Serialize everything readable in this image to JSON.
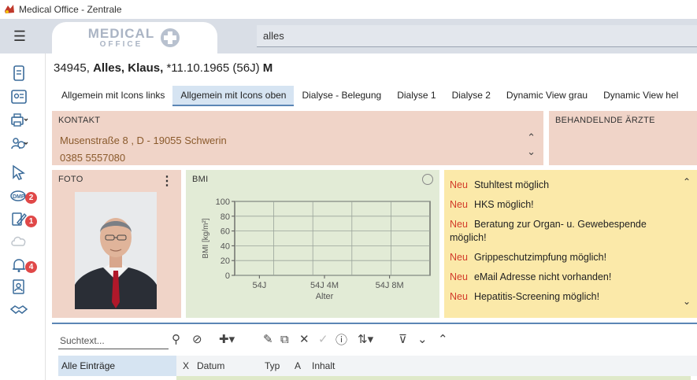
{
  "window": {
    "title": "Medical Office - Zentrale"
  },
  "header": {
    "logo_line1": "MEDICAL",
    "logo_line2": "OFFICE",
    "search_value": "alles"
  },
  "sidebar": {
    "badges": {
      "dmp": "2",
      "edit": "1",
      "bell": "4"
    },
    "icons": [
      "card-icon",
      "id-card-icon",
      "printer-icon",
      "user-clock-icon",
      "pointer-icon",
      "dmp-icon",
      "edit-document-icon",
      "cloud-icon",
      "bell-icon",
      "document-user-icon",
      "handshake-icon"
    ]
  },
  "patient": {
    "id": "34945,",
    "name": "Alles, Klaus,",
    "birth": "*11.10.1965 (56J)",
    "sex": "M"
  },
  "tabs": [
    {
      "label": "Allgemein mit Icons links",
      "active": false
    },
    {
      "label": "Allgemein mit Icons oben",
      "active": true
    },
    {
      "label": "Dialyse - Belegung",
      "active": false
    },
    {
      "label": "Dialyse 1",
      "active": false
    },
    {
      "label": "Dialyse 2",
      "active": false
    },
    {
      "label": "Dynamic View grau",
      "active": false
    },
    {
      "label": "Dynamic View hel",
      "active": false
    }
  ],
  "kontakt": {
    "label": "KONTAKT",
    "address": "Musenstraße 8 , D - 19055 Schwerin",
    "phone": "0385 5557080"
  },
  "aerzte": {
    "label": "BEHANDELNDE ÄRZTE"
  },
  "foto": {
    "label": "FOTO",
    "menu": "⋮"
  },
  "bmi": {
    "label": "BMI"
  },
  "chart_data": {
    "type": "line",
    "title": "BMI",
    "xlabel": "Alter",
    "ylabel": "BMI [kg/m²]",
    "x_ticks": [
      "54J",
      "54J 4M",
      "54J 8M"
    ],
    "y_ticks": [
      0,
      20,
      40,
      60,
      80,
      100
    ],
    "ylim": [
      0,
      100
    ],
    "grid": true,
    "series": []
  },
  "hints": {
    "tag": "Neu",
    "items": [
      "Stuhltest möglich",
      "HKS möglich!",
      "Beratung zur Organ- u. Gewebespende möglich!",
      "Grippeschutzimpfung möglich!",
      "eMail Adresse nicht vorhanden!",
      "Hepatitis-Screening möglich!"
    ]
  },
  "bottom": {
    "search_placeholder": "Suchtext...",
    "filter_label": "Alle Einträge",
    "columns": [
      "X",
      "Datum",
      "Typ",
      "A",
      "Inhalt"
    ]
  },
  "colors": {
    "kontakt_bg": "#f0d4c8",
    "bmi_bg": "#e2ebd6",
    "hints_bg": "#fbe9a9",
    "neu_red": "#d23b2a",
    "badge_red": "#e04848",
    "accent_blue": "#5b86b5"
  }
}
